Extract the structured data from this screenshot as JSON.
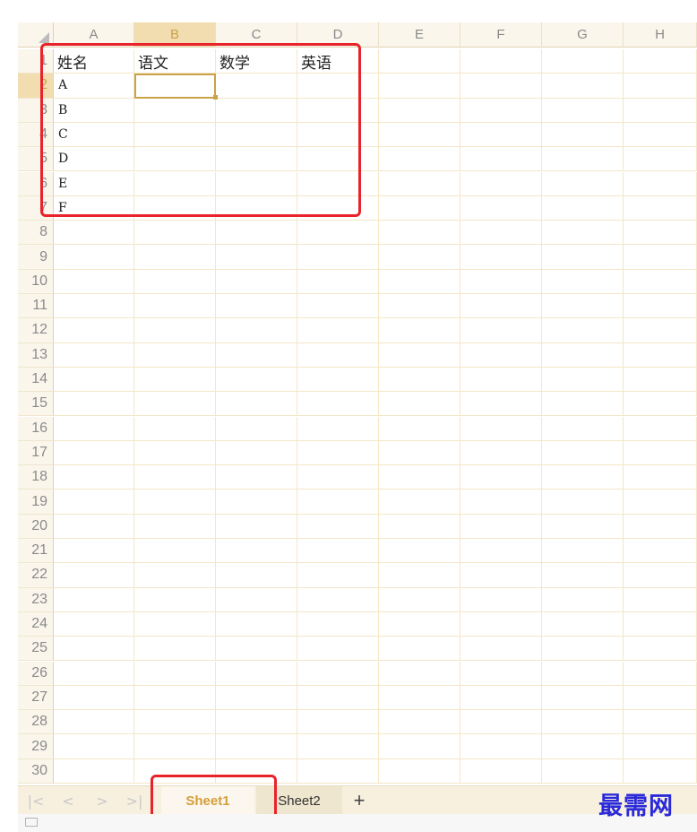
{
  "columns": [
    "A",
    "B",
    "C",
    "D",
    "E",
    "F",
    "G",
    "H"
  ],
  "selected_column": "B",
  "rows": [
    "1",
    "2",
    "3",
    "4",
    "5",
    "6",
    "7",
    "8",
    "9",
    "10",
    "11",
    "12",
    "13",
    "14",
    "15",
    "16",
    "17",
    "18",
    "19",
    "20",
    "21",
    "22",
    "23",
    "24",
    "25",
    "26",
    "27",
    "28",
    "29",
    "30"
  ],
  "selected_row": "2",
  "headers": {
    "A": "姓名",
    "B": "语文",
    "C": "数学",
    "D": "英语"
  },
  "names": [
    "A",
    "B",
    "C",
    "D",
    "E",
    "F"
  ],
  "tabs": {
    "sheet1": "Sheet1",
    "sheet2": "Sheet2",
    "add": "+"
  },
  "nav": {
    "first": "|<",
    "prev": "<",
    "next": ">",
    "last": ">|"
  },
  "watermark": "最需网",
  "colors": {
    "accent": "#c9a24a",
    "highlight": "#e8232b",
    "watermark": "#2a2ad9"
  }
}
